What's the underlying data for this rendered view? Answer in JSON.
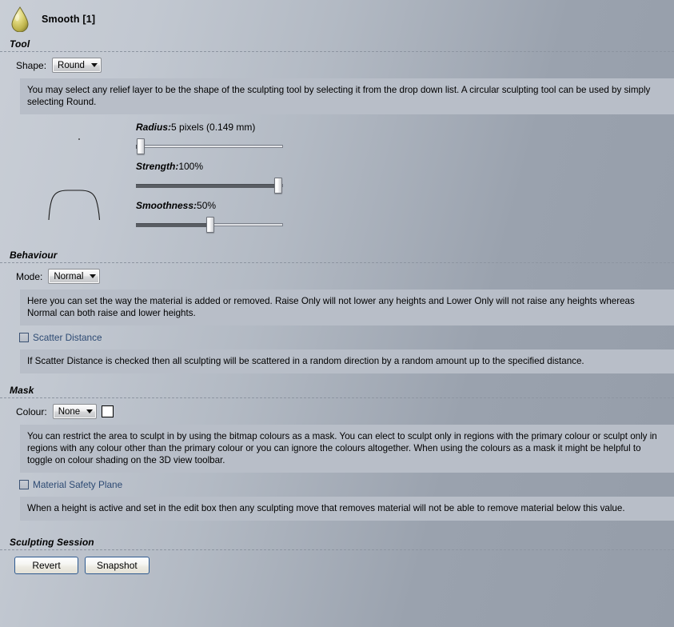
{
  "header": {
    "icon": "droplet-icon",
    "title": "Smooth [1]"
  },
  "sections": {
    "tool": {
      "heading": "Tool",
      "shape_label": "Shape:",
      "shape_value": "Round",
      "info": "You may select any relief layer to be the shape of the sculpting tool by selecting it from the drop down list. A circular sculpting tool can be used by simply selecting Round.",
      "sliders": [
        {
          "name": "radius",
          "label": "Radius:",
          "value_text": "5 pixels (0.149 mm)",
          "percent": 2
        },
        {
          "name": "strength",
          "label": "Strength:",
          "value_text": "100%",
          "percent": 100
        },
        {
          "name": "smoothness",
          "label": "Smoothness:",
          "value_text": "50%",
          "percent": 50
        }
      ]
    },
    "behaviour": {
      "heading": "Behaviour",
      "mode_label": "Mode:",
      "mode_value": "Normal",
      "mode_info": "Here you can set the way the material is added or removed. Raise Only will not lower any heights and Lower Only will not raise any heights whereas Normal can both raise and lower heights.",
      "scatter_label": "Scatter Distance",
      "scatter_checked": false,
      "scatter_info": "If Scatter Distance is checked then all sculpting will be scattered in a random direction by a random amount up to the specified distance."
    },
    "mask": {
      "heading": "Mask",
      "colour_label": "Colour:",
      "colour_value": "None",
      "swatch_color": "#ffffff",
      "colour_info": "You can restrict the area to sculpt in by using the bitmap colours as a mask. You can elect to sculpt only in regions with the primary colour or sculpt only in regions with any colour other than the primary colour or you can ignore the colours altogether. When using the colours as a mask it might be helpful to toggle on colour shading on the 3D view toolbar.",
      "safety_label": "Material Safety Plane",
      "safety_checked": false,
      "safety_info": "When a height is active and set in the edit box then any sculpting move that removes material will not be able to remove material below this value."
    },
    "session": {
      "heading": "Sculpting Session",
      "revert_label": "Revert",
      "snapshot_label": "Snapshot"
    }
  },
  "colors": {
    "info_panel_bg": "#b8bec8",
    "link_text": "#2d4a73",
    "button_border": "#2e5a90",
    "droplet_fill": "#c8c05a"
  }
}
